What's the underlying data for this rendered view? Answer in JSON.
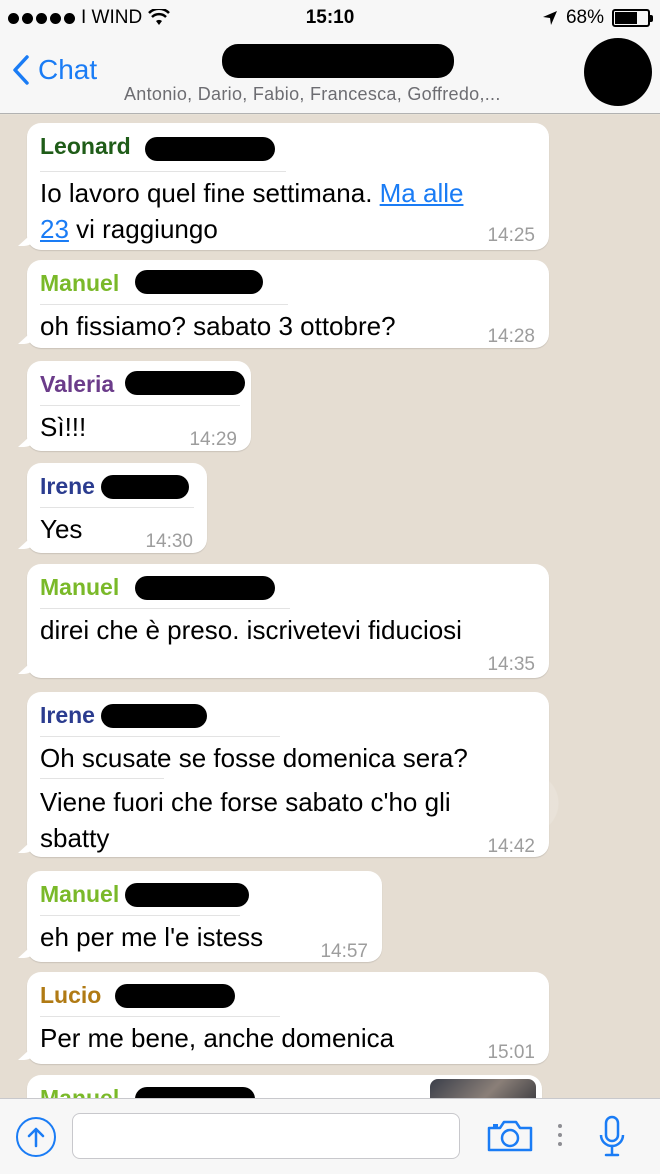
{
  "status_bar": {
    "carrier": "I WIND",
    "time": "15:10",
    "battery": "68%",
    "battery_level": 0.68
  },
  "nav": {
    "back_label": "Chat",
    "subtitle": "Antonio, Dario, Fabio, Francesca, Goffredo,..."
  },
  "messages": [
    {
      "sender": "Leonard",
      "color": "#1f5c18",
      "lines": [
        "Io lavoro quel fine settimana. ",
        "Ma alle",
        "23",
        " vi raggiungo"
      ],
      "time": "14:25"
    },
    {
      "sender": "Manuel",
      "color": "#7ab929",
      "text": "oh fissiamo? sabato 3 ottobre?",
      "time": "14:28"
    },
    {
      "sender": "Valeria",
      "color": "#6b3c8a",
      "text": "Sì!!!",
      "time": "14:29"
    },
    {
      "sender": "Irene",
      "color": "#2b3c8f",
      "text": "Yes",
      "time": "14:30"
    },
    {
      "sender": "Manuel",
      "color": "#7ab929",
      "text": "direi che è preso. iscrivetevi fiduciosi",
      "time": "14:35"
    },
    {
      "sender": "Irene",
      "color": "#2b3c8f",
      "text1": "Oh scusate se fosse domenica sera?",
      "text2a": "Viene fuori che forse sabato c'ho gli",
      "text2b": "sbatty",
      "time": "14:42"
    },
    {
      "sender": "Manuel",
      "color": "#7ab929",
      "text": "eh per me l'e istess",
      "time": "14:57"
    },
    {
      "sender": "Lucio",
      "color": "#b07a14",
      "text": "Per me bene, anche domenica",
      "time": "15:01"
    },
    {
      "sender": "Manuel",
      "color": "#7ab929"
    }
  ],
  "input": {
    "placeholder": ""
  },
  "icons": {
    "back": "chevron-left-icon",
    "share": "upload-arrow-icon",
    "camera": "camera-icon",
    "mic": "microphone-icon",
    "wifi": "wifi-icon",
    "location": "location-arrow-icon",
    "battery": "battery-icon"
  }
}
